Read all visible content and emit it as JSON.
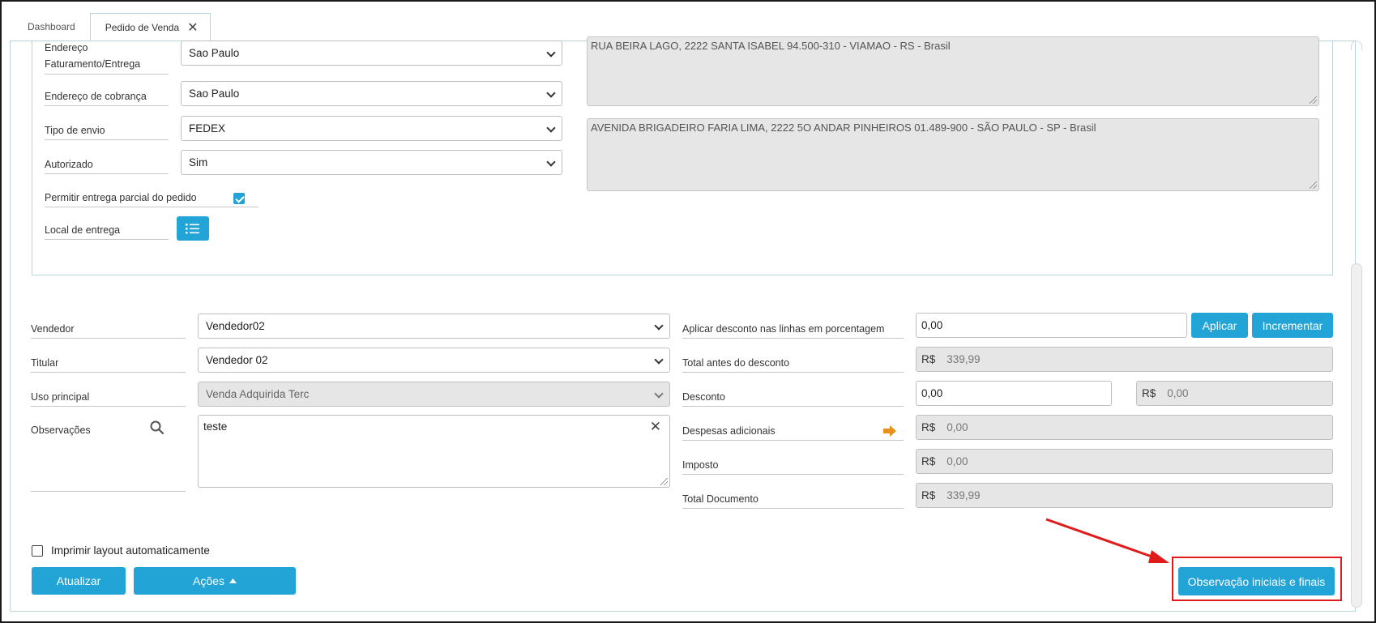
{
  "tabs": [
    {
      "label": "Dashboard"
    },
    {
      "label": "Pedido de Venda"
    }
  ],
  "address": {
    "faturamento_label": "Endereço Faturamento/Entrega",
    "faturamento_value": "Sao Paulo",
    "faturamento_text": "RUA BEIRA LAGO, 2222  SANTA ISABEL 94.500-310 - VIAMAO - RS - Brasil",
    "cobranca_label": "Endereço de cobrança",
    "cobranca_value": "Sao Paulo",
    "cobranca_text": "AVENIDA BRIGADEIRO FARIA LIMA, 2222 5O ANDAR PINHEIROS 01.489-900 - SÃO PAULO - SP - Brasil",
    "envio_label": "Tipo de envio",
    "envio_value": "FEDEX",
    "autorizado_label": "Autorizado",
    "autorizado_value": "Sim",
    "parcial_label": "Permitir entrega parcial do pedido",
    "local_label": "Local de entrega"
  },
  "form": {
    "vendedor_label": "Vendedor",
    "vendedor_value": "Vendedor02",
    "titular_label": "Titular",
    "titular_value": "Vendedor 02",
    "uso_label": "Uso principal",
    "uso_value": "Venda Adquirida Terc",
    "obs_label": "Observações",
    "obs_value": "teste"
  },
  "totals": {
    "currency": "R$",
    "desconto_pct_label": "Aplicar desconto nas linhas em porcentagem",
    "desconto_pct_value": "0,00",
    "aplicar_label": "Aplicar",
    "incrementar_label": "Incrementar",
    "antes_label": "Total antes do desconto",
    "antes_value": "339,99",
    "desconto_label": "Desconto",
    "desconto_input": "0,00",
    "desconto_value": "0,00",
    "despesas_label": "Despesas adicionais",
    "despesas_value": "0,00",
    "imposto_label": "Imposto",
    "imposto_value": "0,00",
    "total_label": "Total Documento",
    "total_value": "339,99"
  },
  "footer": {
    "imprimir_label": "Imprimir layout automaticamente",
    "atualizar_label": "Atualizar",
    "acoes_label": "Ações",
    "obs_button_label": "Observação iniciais e finais"
  },
  "colors": {
    "accent": "#22a4d7",
    "annotation": "#e01b1b",
    "arrow_icon": "#e8911a"
  },
  "icons": [
    "close-icon",
    "chevron-down-icon",
    "list-icon",
    "search-icon",
    "clear-icon",
    "arrow-right-icon",
    "caret-up-icon",
    "checkmark-icon"
  ]
}
